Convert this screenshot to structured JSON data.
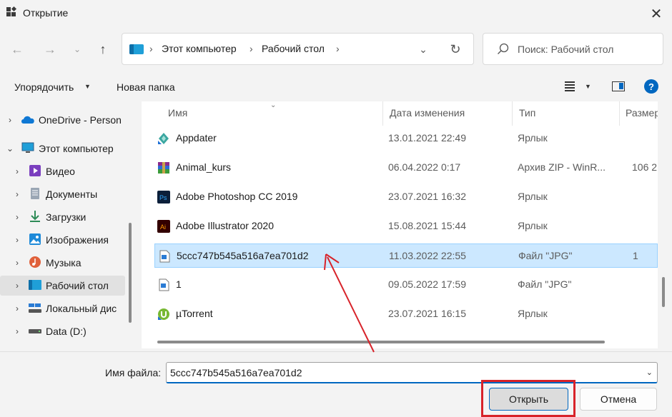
{
  "window": {
    "title": "Открытие"
  },
  "address": {
    "crumbs": [
      "Этот компьютер",
      "Рабочий стол"
    ]
  },
  "search": {
    "placeholder": "Поиск: Рабочий стол"
  },
  "toolbar": {
    "organize_label": "Упорядочить",
    "new_folder_label": "Новая папка"
  },
  "sidebar": {
    "items": [
      {
        "label": "OneDrive - Person",
        "icon": "onedrive-icon"
      },
      {
        "label": "Этот компьютер",
        "icon": "computer-icon"
      },
      {
        "label": "Видео",
        "icon": "video-icon"
      },
      {
        "label": "Документы",
        "icon": "documents-icon"
      },
      {
        "label": "Загрузки",
        "icon": "downloads-icon"
      },
      {
        "label": "Изображения",
        "icon": "pictures-icon"
      },
      {
        "label": "Музыка",
        "icon": "music-icon"
      },
      {
        "label": "Рабочий стол",
        "icon": "desktop-icon",
        "selected": true
      },
      {
        "label": "Локальный дис",
        "icon": "local-disk-icon"
      },
      {
        "label": "Data (D:)",
        "icon": "drive-icon"
      }
    ]
  },
  "filelist": {
    "columns": {
      "name": "Имя",
      "date": "Дата изменения",
      "type": "Тип",
      "size": "Размер"
    },
    "rows": [
      {
        "name": "Appdater",
        "date": "13.01.2021 22:49",
        "type": "Ярлык",
        "size": "",
        "icon": "appdater-icon"
      },
      {
        "name": "Animal_kurs",
        "date": "06.04.2022 0:17",
        "type": "Архив ZIP - WinR...",
        "size": "106 2",
        "icon": "winrar-icon"
      },
      {
        "name": "Adobe Photoshop CC 2019",
        "date": "23.07.2021 16:32",
        "type": "Ярлык",
        "size": "",
        "icon": "photoshop-icon"
      },
      {
        "name": "Adobe Illustrator 2020",
        "date": "15.08.2021 15:44",
        "type": "Ярлык",
        "size": "",
        "icon": "illustrator-icon"
      },
      {
        "name": "5ccc747b545a516a7ea701d2",
        "date": "11.03.2022 22:55",
        "type": "Файл \"JPG\"",
        "size": "1",
        "icon": "image-file-icon",
        "selected": true
      },
      {
        "name": "1",
        "date": "09.05.2022 17:59",
        "type": "Файл \"JPG\"",
        "size": "",
        "icon": "image-file-icon"
      },
      {
        "name": "µTorrent",
        "date": "23.07.2021 16:15",
        "type": "Ярлык",
        "size": "",
        "icon": "utorrent-icon"
      }
    ]
  },
  "footer": {
    "filename_label": "Имя файла:",
    "filename_value": "5ccc747b545a516a7ea701d2",
    "open_label": "Открыть",
    "cancel_label": "Отмена"
  },
  "colors": {
    "accent": "#0067c0",
    "selection": "#cce8ff",
    "annotation": "#d8232a"
  }
}
